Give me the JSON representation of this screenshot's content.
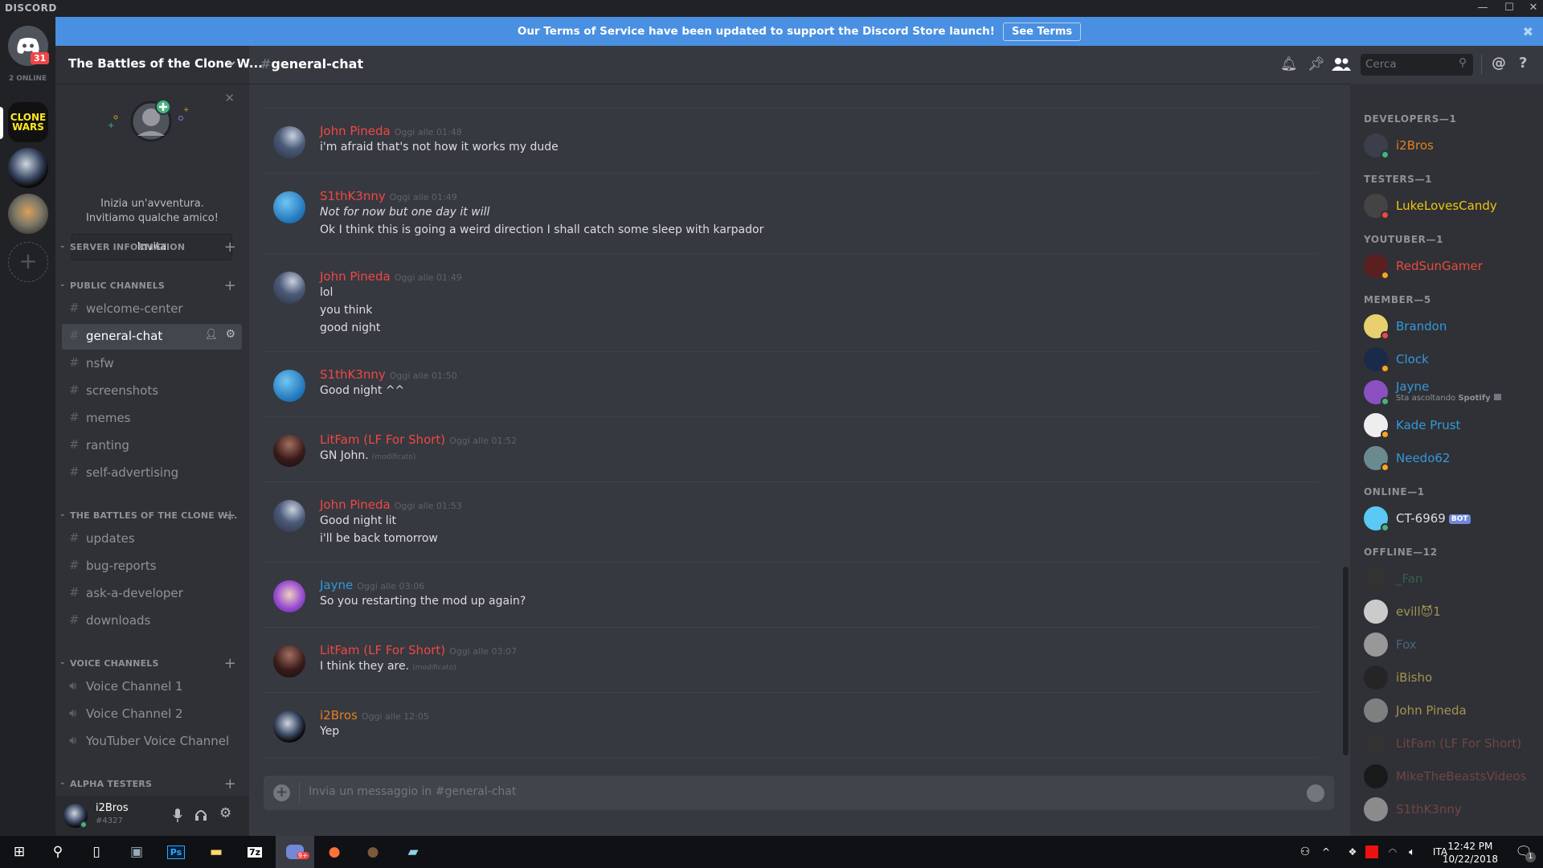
{
  "window": {
    "app_logo": "DISCORD",
    "minimize": "—",
    "maximize": "☐",
    "close": "✕"
  },
  "guilds": {
    "unread_badge": "31",
    "online_count": "2 ONLINE",
    "clone_wars_logo": "CLONE WARS",
    "add_server": "+"
  },
  "banner": {
    "text": "Our Terms of Service have been updated to support the Discord Store launch!",
    "button": "See Terms",
    "close": "✖",
    "color": "#4a90e2"
  },
  "server": {
    "name": "The Battles of the Clone W...",
    "chevron": "⌄"
  },
  "invite": {
    "line1": "Inizia un'avventura.",
    "line2": "Invitiamo qualche amico!",
    "button": "Invita",
    "close": "✕"
  },
  "categories": [
    {
      "name": "SERVER INFORMATION",
      "channels": []
    },
    {
      "name": "PUBLIC CHANNELS",
      "channels": [
        "welcome-center",
        "general-chat",
        "nsfw",
        "screenshots",
        "memes",
        "ranting",
        "self-advertising"
      ]
    },
    {
      "name": "THE BATTLES OF THE CLONE W...",
      "channels": [
        "updates",
        "bug-reports",
        "ask-a-developer",
        "downloads"
      ]
    },
    {
      "name": "VOICE CHANNELS",
      "channels": [
        "Voice Channel 1",
        "Voice Channel 2",
        "YouTuber Voice Channel"
      ]
    },
    {
      "name": "ALPHA TESTERS",
      "channels": []
    }
  ],
  "selected_channel": "general-chat",
  "user": {
    "name": "i2Bros",
    "tag": "#4327"
  },
  "header": {
    "channel": "general-chat",
    "search_placeholder": "Cerca"
  },
  "messages": [
    {
      "author": "John Pineda",
      "color": "#f04747",
      "time": "Oggi alle 01:48",
      "lines": [
        {
          "text": "i'm afraid that's not how it works my dude"
        }
      ]
    },
    {
      "author": "S1thK3nny",
      "color": "#f04747",
      "time": "Oggi alle 01:49",
      "lines": [
        {
          "text": "Not for now but one day it will",
          "italic": true
        },
        {
          "text": "Ok I think this is going a weird direction I shall catch some sleep with karpador"
        }
      ]
    },
    {
      "author": "John Pineda",
      "color": "#f04747",
      "time": "Oggi alle 01:49",
      "lines": [
        {
          "text": "lol"
        },
        {
          "text": "you think"
        },
        {
          "text": "good night"
        }
      ]
    },
    {
      "author": "S1thK3nny",
      "color": "#f04747",
      "time": "Oggi alle 01:50",
      "lines": [
        {
          "text": "Good night ^^"
        }
      ]
    },
    {
      "author": "LitFam (LF For Short)",
      "color": "#f04747",
      "time": "Oggi alle 01:52",
      "lines": [
        {
          "text": "GN John.",
          "edited": "(modificato)"
        }
      ]
    },
    {
      "author": "John Pineda",
      "color": "#f04747",
      "time": "Oggi alle 01:53",
      "lines": [
        {
          "text": "Good night lit"
        },
        {
          "text": "i'll be back tomorrow"
        }
      ]
    },
    {
      "author": "Jayne",
      "color": "#3498db",
      "time": "Oggi alle 03:06",
      "lines": [
        {
          "text": "So you restarting the mod up again?"
        }
      ]
    },
    {
      "author": "LitFam (LF For Short)",
      "color": "#f04747",
      "time": "Oggi alle 03:07",
      "lines": [
        {
          "text": "I think they are.",
          "edited": "(modificato)"
        }
      ]
    },
    {
      "author": "i2Bros",
      "color": "#e67e22",
      "time": "Oggi alle 12:05",
      "lines": [
        {
          "text": "Yep"
        }
      ]
    }
  ],
  "input": {
    "placeholder": "Invia un messaggio in #general-chat"
  },
  "member_groups": [
    {
      "title": "DEVELOPERS—1",
      "members": [
        {
          "name": "i2Bros",
          "color": "#e67e22",
          "status": "online"
        }
      ]
    },
    {
      "title": "TESTERS—1",
      "members": [
        {
          "name": "LukeLovesCandy",
          "color": "#f1c40f",
          "status": "dnd"
        }
      ]
    },
    {
      "title": "YOUTUBER—1",
      "members": [
        {
          "name": "RedSunGamer",
          "color": "#e74c3c",
          "status": "idle"
        }
      ]
    },
    {
      "title": "MEMBER—5",
      "members": [
        {
          "name": "Brandon",
          "color": "#3498db",
          "status": "dnd"
        },
        {
          "name": "Clock",
          "color": "#3498db",
          "status": "idle"
        },
        {
          "name": "Jayne",
          "color": "#3498db",
          "status": "online",
          "activity": "Sta ascoltando",
          "activity_app": "Spotify"
        },
        {
          "name": "Kade Prust",
          "color": "#3498db",
          "status": "idle"
        },
        {
          "name": "Needo62",
          "color": "#3498db",
          "status": "idle"
        }
      ]
    },
    {
      "title": "ONLINE—1",
      "members": [
        {
          "name": "CT-6969",
          "color": "#dcddde",
          "status": "online",
          "bot": "BOT"
        }
      ]
    },
    {
      "title": "OFFLINE—12",
      "members": [
        {
          "name": "_Fan",
          "color": "#3c6e54",
          "status": "offline"
        },
        {
          "name": "evill😈1",
          "color": "#c9b458",
          "status": "offline"
        },
        {
          "name": "Fox",
          "color": "#4f7895",
          "status": "offline"
        },
        {
          "name": "iBisho",
          "color": "#c9b458",
          "status": "offline"
        },
        {
          "name": "John Pineda",
          "color": "#c9b458",
          "status": "offline"
        },
        {
          "name": "LitFam (LF For Short)",
          "color": "#8a4b4b",
          "status": "offline"
        },
        {
          "name": "MikeTheBeastsVideos",
          "color": "#8a4b4b",
          "status": "offline"
        },
        {
          "name": "S1thK3nny",
          "color": "#8a4b4b",
          "status": "offline"
        }
      ]
    }
  ],
  "taskbar": {
    "time": "12:42 PM",
    "date": "10/22/2018",
    "language": "ITA",
    "discord_badge": "9+",
    "notifications": "1",
    "photoshop": "Ps",
    "sevenzip": "7z"
  }
}
